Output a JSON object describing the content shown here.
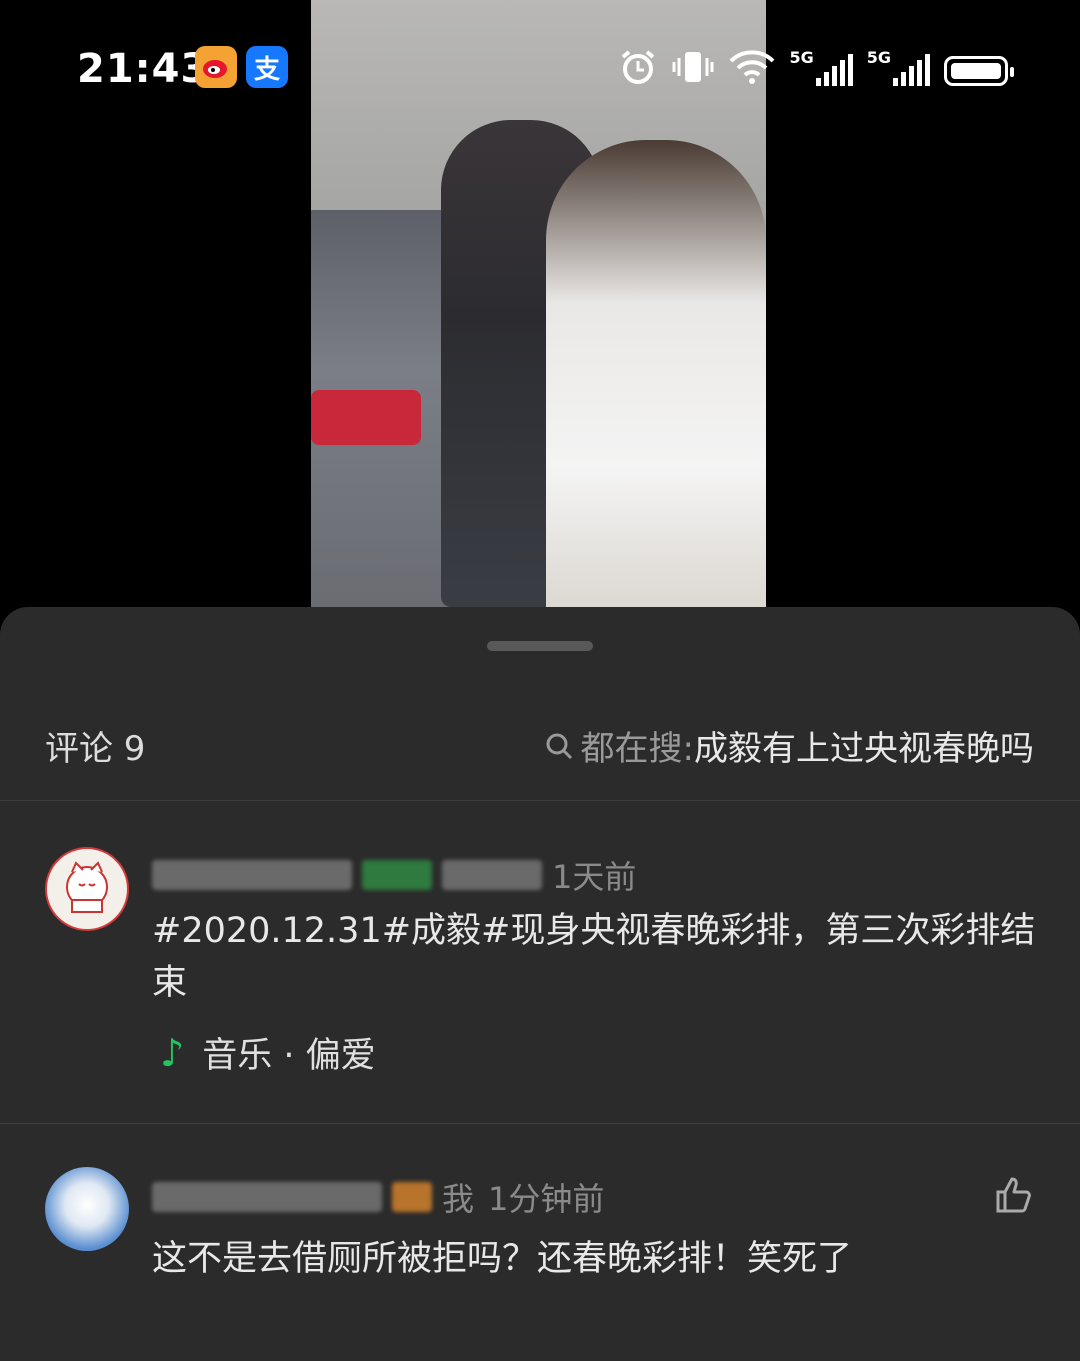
{
  "status_bar": {
    "time": "21:43",
    "apps": [
      "weibo-icon",
      "alipay-icon"
    ],
    "alipay_glyph": "支",
    "network1": "5G",
    "network2": "5G"
  },
  "panel": {
    "comment_label": "评论 9",
    "search_prefix": "都在搜: ",
    "search_term": "成毅有上过央视春晚吗"
  },
  "comments": [
    {
      "time": "1天前",
      "text": "#2020.12.31#成毅#现身央视春晚彩排，第三次彩排结束",
      "music": "音乐 · 偏爱"
    },
    {
      "name_visible": "我",
      "time": "1分钟前",
      "text": "这不是去借厕所被拒吗？还春晚彩排！笑死了"
    }
  ],
  "colors": {
    "panel_bg": "#2b2b2b",
    "music_accent": "#22c55e"
  }
}
